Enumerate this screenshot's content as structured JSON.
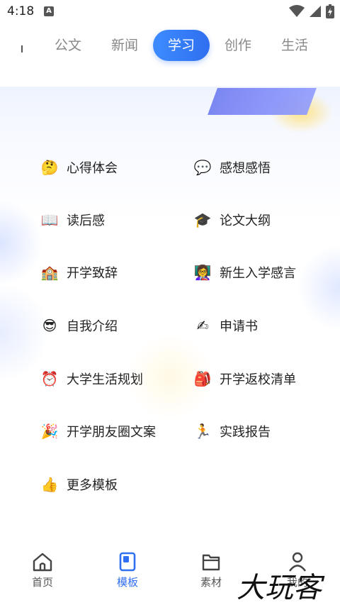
{
  "status_bar": {
    "time": "4:18",
    "notification_icon": "A"
  },
  "tabs": [
    {
      "label": "公文",
      "active": false
    },
    {
      "label": "新闻",
      "active": false
    },
    {
      "label": "学习",
      "active": true
    },
    {
      "label": "创作",
      "active": false
    },
    {
      "label": "生活",
      "active": false
    }
  ],
  "templates": [
    {
      "icon": "🤔",
      "label": "心得体会"
    },
    {
      "icon": "💬",
      "label": "感想感悟"
    },
    {
      "icon": "📖",
      "label": "读后感"
    },
    {
      "icon": "🎓",
      "label": "论文大纲"
    },
    {
      "icon": "🏫",
      "label": "开学致辞"
    },
    {
      "icon": "👩‍🏫",
      "label": "新生入学感言"
    },
    {
      "icon": "😎",
      "label": "自我介绍"
    },
    {
      "icon": "✍",
      "label": "申请书"
    },
    {
      "icon": "⏰",
      "label": "大学生活规划"
    },
    {
      "icon": "🎒",
      "label": "开学返校清单"
    },
    {
      "icon": "🎉",
      "label": "开学朋友圈文案"
    },
    {
      "icon": "🏃",
      "label": "实践报告"
    },
    {
      "icon": "👍",
      "label": "更多模板"
    }
  ],
  "bottom_nav": [
    {
      "label": "首页",
      "icon": "home-icon",
      "active": false
    },
    {
      "label": "模板",
      "icon": "template-icon",
      "active": true
    },
    {
      "label": "素材",
      "icon": "folder-icon",
      "active": false
    },
    {
      "label": "我的",
      "icon": "user-icon",
      "active": false
    }
  ],
  "watermark": "大玩客",
  "colors": {
    "accent": "#2f6ff0",
    "text": "#222222",
    "muted": "#888888"
  }
}
